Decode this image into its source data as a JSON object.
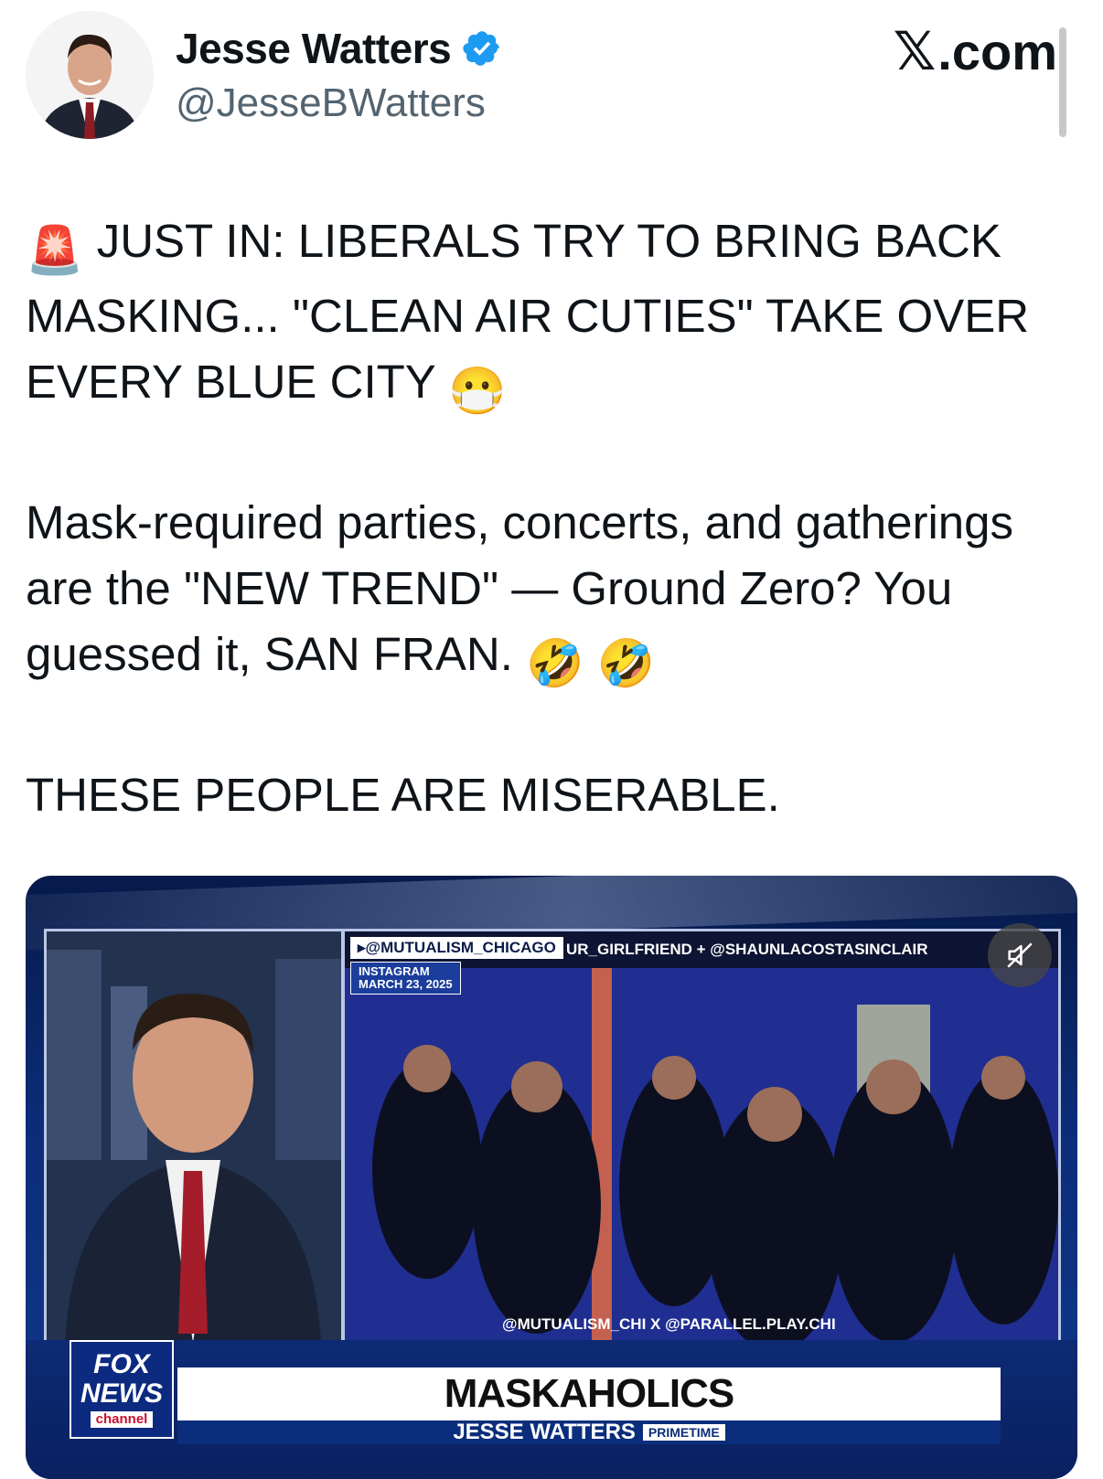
{
  "author": {
    "name": "Jesse Watters",
    "handle": "@JesseBWatters",
    "verified": true
  },
  "site": {
    "logo": "𝕏",
    "label": ".com"
  },
  "tweet": {
    "line1_emoji": "🚨",
    "headline": "JUST IN: LIBERALS TRY TO BRING BACK MASKING... \"CLEAN AIR CUTIES\" TAKE OVER EVERY BLUE CITY",
    "headline_emoji": "😷",
    "body": "Mask-required parties, concerts, and gatherings are the \"NEW TREND\" — Ground Zero? You guessed it, SAN FRAN.",
    "body_emoji": "🤣 🤣",
    "closing": "THESE PEOPLE ARE MISERABLE."
  },
  "video": {
    "source_tag": "▸@MUTUALISM_CHICAGO",
    "meta_line1": "INSTAGRAM",
    "meta_line2": "MARCH 23, 2025",
    "collab_tag": "UR_GIRLFRIEND + @SHAUNLACOSTASINCLAIR",
    "bottom_tag": "@MUTUALISM_CHI X @PARALLEL.PLAY.CHI",
    "network_line1": "FOX",
    "network_line2": "NEWS",
    "network_line3": "channel",
    "headline": "MASKAHOLICS",
    "show_name": "JESSE WATTERS",
    "show_tag": "PRIMETIME",
    "mute_icon": "speaker-muted-icon"
  },
  "colors": {
    "verified_blue": "#1d9bf0",
    "handle_gray": "#536471",
    "fox_red": "#c8102e",
    "fox_blue": "#0b2e7c"
  }
}
